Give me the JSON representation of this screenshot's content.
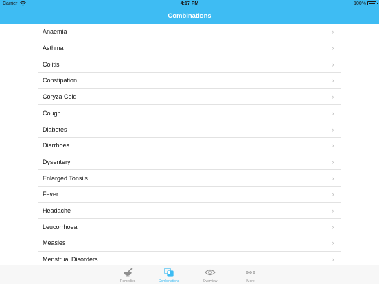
{
  "status_bar": {
    "carrier": "Carrier",
    "time": "4:17 PM",
    "battery": "100%"
  },
  "nav": {
    "title": "Combinations"
  },
  "list": {
    "items": [
      "Anaemia",
      "Asthma",
      "Colitis",
      "Constipation",
      "Coryza Cold",
      "Cough",
      "Diabetes",
      "Diarrhoea",
      "Dysentery",
      "Enlarged Tonsils",
      "Fever",
      "Headache",
      "Leucorrhoea",
      "Measles",
      "Menstrual Disorders"
    ],
    "chevron": "›"
  },
  "tab_bar": {
    "tabs": [
      {
        "label": "Remedies",
        "icon": "mortar-pestle-icon",
        "active": false
      },
      {
        "label": "Combinations",
        "icon": "overlapping-squares-icon",
        "active": true
      },
      {
        "label": "Overview",
        "icon": "eye-icon",
        "active": false
      },
      {
        "label": "More",
        "icon": "more-dots-icon",
        "active": false
      }
    ]
  },
  "colors": {
    "accent": "#3ebcf3",
    "inactive": "#8e8e8e"
  }
}
